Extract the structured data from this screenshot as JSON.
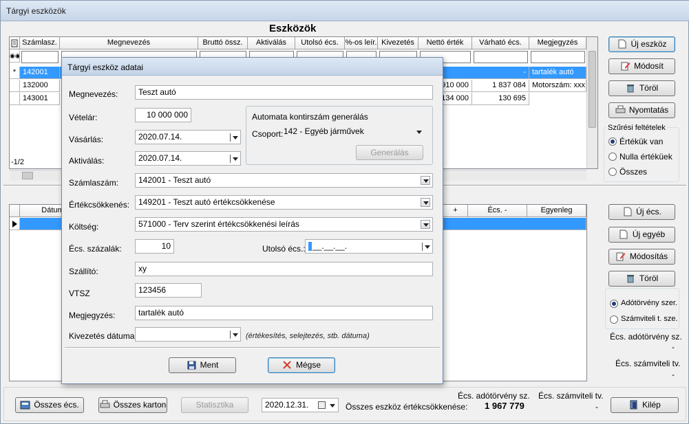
{
  "window": {
    "title": "Tárgyi eszközök"
  },
  "assets": {
    "caption": "Eszközök",
    "columns": [
      "Számlasz.",
      "Megnevezés",
      "Bruttó össz.",
      "Aktiválás",
      "Utolsó écs.",
      "%-os leír.",
      "Kivezetés",
      "Nettó érték",
      "Várható écs.",
      "Megjegyzés"
    ],
    "rows": [
      {
        "marker": "*",
        "code": "142001",
        "net": "",
        "expected": "-",
        "note": "tartalék autó"
      },
      {
        "marker": "",
        "code": "132000",
        "net": "910 000",
        "expected": "1 837 084",
        "note": "Motorszám: xxx"
      },
      {
        "marker": "",
        "code": "143001",
        "net": "134 000",
        "expected": "130 695",
        "note": ""
      }
    ],
    "record_counter": "-1/2"
  },
  "side_buttons": {
    "new_asset": "Új eszköz",
    "modify": "Módosít",
    "delete": "Töröl",
    "print": "Nyomtatás"
  },
  "filters": {
    "title": "Szűrési feltételek",
    "options": [
      {
        "label": "Értékük van",
        "selected": true
      },
      {
        "label": "Nulla értéküek",
        "selected": false
      },
      {
        "label": "Összes",
        "selected": false
      }
    ]
  },
  "depreciation": {
    "columns": [
      "Dátum",
      "+",
      "Écs. -",
      "Egyenleg"
    ],
    "buttons": {
      "new_dep": "Új écs.",
      "new_other": "Új egyéb",
      "modify": "Módosítás",
      "delete": "Töröl"
    },
    "options": [
      {
        "label": "Adótörvény szer.",
        "selected": true
      },
      {
        "label": "Számviteli t. sze.",
        "selected": false
      }
    ],
    "tax_label": "Écs. adótörvény sz.",
    "tax_value": "-",
    "acc_label": "Écs. számviteli tv.",
    "acc_value": "-"
  },
  "bottom": {
    "all_dep": "Összes écs.",
    "all_cards": "Összes karton",
    "statistics": "Statisztika",
    "date": "2020.12.31.",
    "total_label": "Összes eszköz értékcsökkenése:",
    "tax_header": "Écs. adótörvény sz.",
    "acc_header": "Écs. számviteli tv.",
    "tax_total": "1 967 779",
    "acc_total": "-",
    "exit": "Kilép"
  },
  "dialog": {
    "title": "Tárgyi eszköz adatai",
    "name_label": "Megnevezés:",
    "name_value": "Teszt autó",
    "price_label": "Vételár:",
    "price_value": "10 000 000",
    "purchase_label": "Vásárlás:",
    "purchase_value": "2020.07.14.",
    "activation_label": "Aktiválás:",
    "activation_value": "2020.07.14.",
    "auto_group_title": "Automata kontirszám generálás",
    "group_label": "Csoport:",
    "group_value": "142 - Egyéb járművek",
    "generate_button": "Generálás",
    "account_label": "Számlaszám:",
    "account_value": "142001 - Teszt autó",
    "dep_account_label": "Értékcsökkenés:",
    "dep_account_value": "149201 - Teszt autó értékcsökkenése",
    "cost_label": "Költség:",
    "cost_value": "571000 - Terv szerint értékcsökkenési leírás",
    "dep_percent_label": "Écs. százalák:",
    "dep_percent_value": "10",
    "last_dep_label": "Utolsó écs.:",
    "last_dep_value": "__.__.__.",
    "supplier_label": "Szállító:",
    "supplier_value": "xy",
    "vtsz_label": "VTSZ",
    "vtsz_value": "123456",
    "note_label": "Megjegyzés:",
    "note_value": "tartalék autó",
    "disposal_label": "Kivezetés dátuma:",
    "disposal_value": "",
    "disposal_hint": "(értékesítés, selejtezés, stb. dátuma)",
    "ok_button": "Ment",
    "cancel_button": "Mégse"
  },
  "colors": {
    "selection": "#3399ff",
    "accent": "#1d3f7a"
  }
}
